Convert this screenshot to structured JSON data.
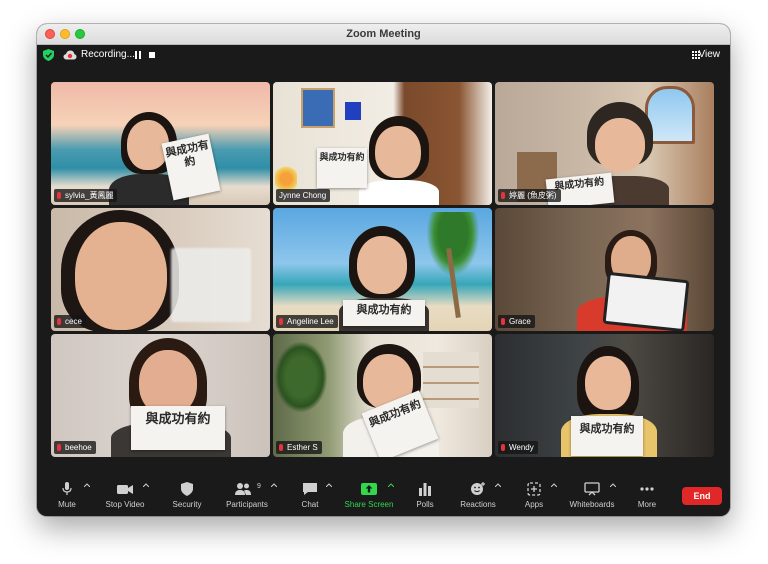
{
  "window": {
    "title": "Zoom Meeting"
  },
  "topbar": {
    "recording_label": "Recording...",
    "view_label": "View"
  },
  "gallery": {
    "participants": [
      {
        "name": "sylvia_黃鳳麗",
        "card_text": "與成功有約"
      },
      {
        "name": "Jynne Chong",
        "card_text": "與成功有約"
      },
      {
        "name": "婷麗 (魚皮粥)",
        "card_text": "與成功有約"
      },
      {
        "name": "cece",
        "card_text": ""
      },
      {
        "name": "Angeline Lee",
        "card_text": "與成功有約"
      },
      {
        "name": "Grace",
        "card_text": ""
      },
      {
        "name": "beehoe",
        "card_text": "與成功有約"
      },
      {
        "name": "Esther S",
        "card_text": "與成功有約"
      },
      {
        "name": "Wendy",
        "card_text": "與成功有約"
      }
    ],
    "active_speaker_index": 1
  },
  "toolbar": {
    "mute": "Mute",
    "stop_video": "Stop Video",
    "security": "Security",
    "participants": "Participants",
    "participant_count": "9",
    "chat": "Chat",
    "share_screen": "Share Screen",
    "polls": "Polls",
    "reactions": "Reactions",
    "apps": "Apps",
    "whiteboards": "Whiteboards",
    "more": "More",
    "end": "End"
  },
  "colors": {
    "active_border": "#2fe03a",
    "share_green": "#32d74b",
    "end_red": "#e02828",
    "muted_red": "#e8323c"
  }
}
